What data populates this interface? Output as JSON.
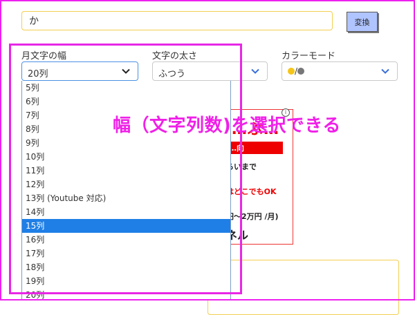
{
  "input": {
    "value": "か"
  },
  "convert_button": {
    "label": "変換"
  },
  "width_select": {
    "label": "月文字の幅",
    "value": "20列",
    "options": [
      "5列",
      "6列",
      "7列",
      "8列",
      "9列",
      "10列",
      "11列",
      "12列",
      "13列 (Youtube 対応)",
      "14列",
      "15列",
      "16列",
      "17列",
      "18列",
      "19列",
      "20列"
    ],
    "highlighted_index": 10
  },
  "weight_select": {
    "label": "文字の太さ",
    "value": "ふつう"
  },
  "color_select": {
    "label": "カラーモード",
    "separator": "/",
    "colors": [
      "#f5c518",
      "#777777"
    ]
  },
  "ad": {
    "info": "i",
    "title": "…ぶ…",
    "bar_text": "…向",
    "line1": "らいまで",
    "line2": "はどこでもOK",
    "line3": "円～2万円 /月)",
    "line4": "ネル"
  },
  "annotation": {
    "text": "幅（文字列数)を選択できる",
    "color": "#f020e8"
  },
  "colors": {
    "accent": "#1f7fe6",
    "highlight": "#e826e6",
    "input_border": "#f2cf4d"
  }
}
